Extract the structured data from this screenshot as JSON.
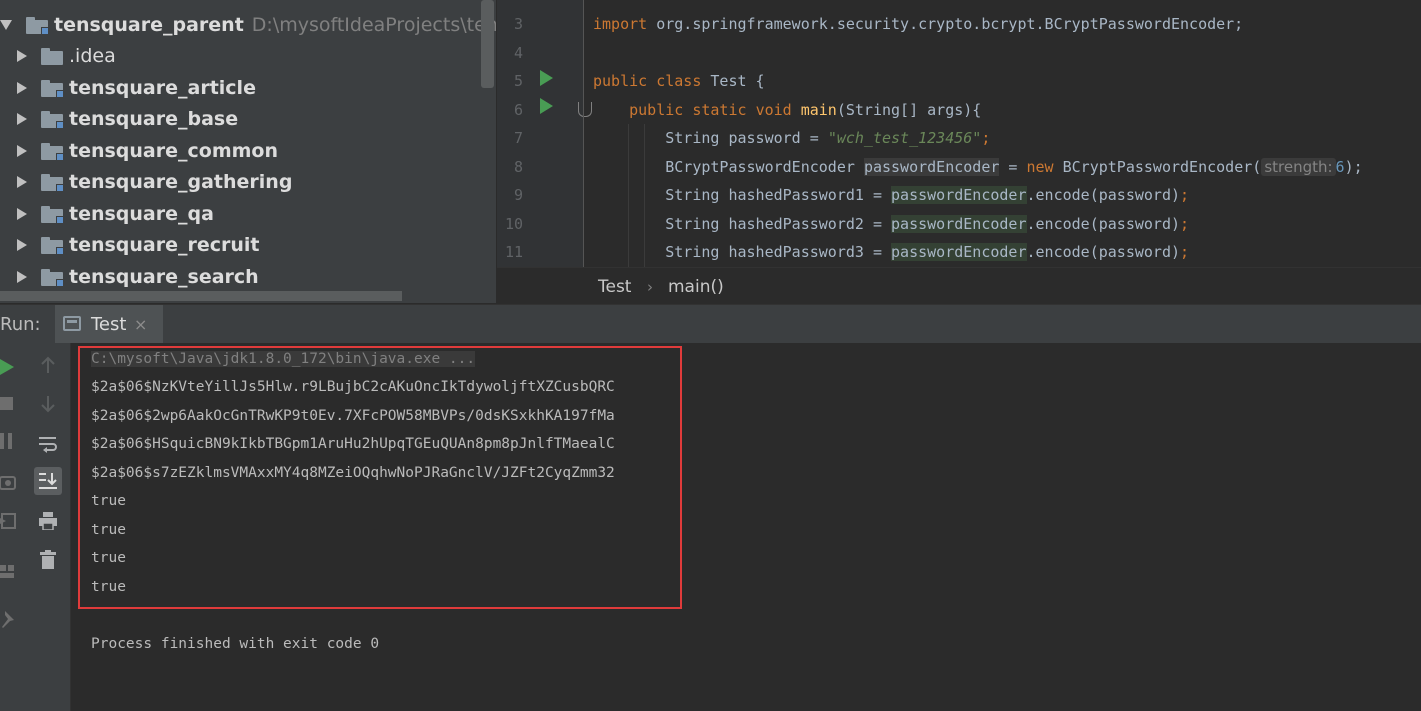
{
  "project_tree": {
    "root": {
      "name": "tensquare_parent",
      "path": "D:\\mysoftIdeaProjects\\tensquare_"
    },
    "items": [
      {
        "name": ".idea",
        "bold": false
      },
      {
        "name": "tensquare_article",
        "bold": true
      },
      {
        "name": "tensquare_base",
        "bold": true
      },
      {
        "name": "tensquare_common",
        "bold": true
      },
      {
        "name": "tensquare_gathering",
        "bold": true
      },
      {
        "name": "tensquare_qa",
        "bold": true
      },
      {
        "name": "tensquare_recruit",
        "bold": true
      },
      {
        "name": "tensquare_search",
        "bold": true
      }
    ]
  },
  "editor": {
    "line_numbers": [
      "3",
      "4",
      "5",
      "6",
      "7",
      "8",
      "9",
      "10",
      "11"
    ],
    "code": {
      "import_kw": "import",
      "import_pkg": " org.springframework.security.crypto.bcrypt.BCryptPasswordEncoder;",
      "public_kw": "public",
      "class_kw": "class",
      "class_name": " Test {",
      "static_kw": "static",
      "void_kw": "void",
      "main_fn": "main",
      "main_args": "(String[] args){",
      "string_type": "String",
      "password_var": " password = ",
      "password_val": "\"wch_test_123456\"",
      "semicolon": ";",
      "encoder_type": "BCryptPasswordEncoder ",
      "encoder_var": "passwordEncoder",
      "assign": " = ",
      "new_kw": "new",
      "encoder_ctor": " BCryptPasswordEncoder(",
      "hint_strength": "strength:",
      "strength_value": "6",
      "ctor_close": ");",
      "hashed1": " hashedPassword1 = ",
      "hashed2": " hashedPassword2 = ",
      "hashed3": " hashedPassword3 = ",
      "encode_call": ".encode(password)"
    }
  },
  "breadcrumb": {
    "class": "Test",
    "separator": "›",
    "method": "main()"
  },
  "run_panel": {
    "label": "Run:",
    "tab": "Test",
    "tab_close": "×",
    "console": {
      "command": "C:\\mysoft\\Java\\jdk1.8.0_172\\bin\\java.exe ...",
      "hashes": [
        "$2a$06$NzKVteYillJs5Hlw.r9LBujbC2cAKuOncIkTdywoljftXZCusbQRC",
        "$2a$06$2wp6AakOcGnTRwKP9t0Ev.7XFcPOW58MBVPs/0dsKSxkhKA197fMa",
        "$2a$06$HSquicBN9kIkbTBGpm1AruHu2hUpqTGEuQUAn8pm8pJnlfTMaealC",
        "$2a$06$s7zEZklmsVMAxxMY4q8MZeiOQqhwNoPJRaGnclV/JZFt2CyqZmm32"
      ],
      "results": [
        "true",
        "true",
        "true",
        "true"
      ],
      "exit": "Process finished with exit code 0"
    }
  },
  "colors": {
    "keyword": "#cc7832",
    "string": "#6a8759",
    "function": "#ffc66d",
    "number": "#6897bb",
    "highlight_box": "#e03b3b",
    "run_green": "#499c54"
  }
}
